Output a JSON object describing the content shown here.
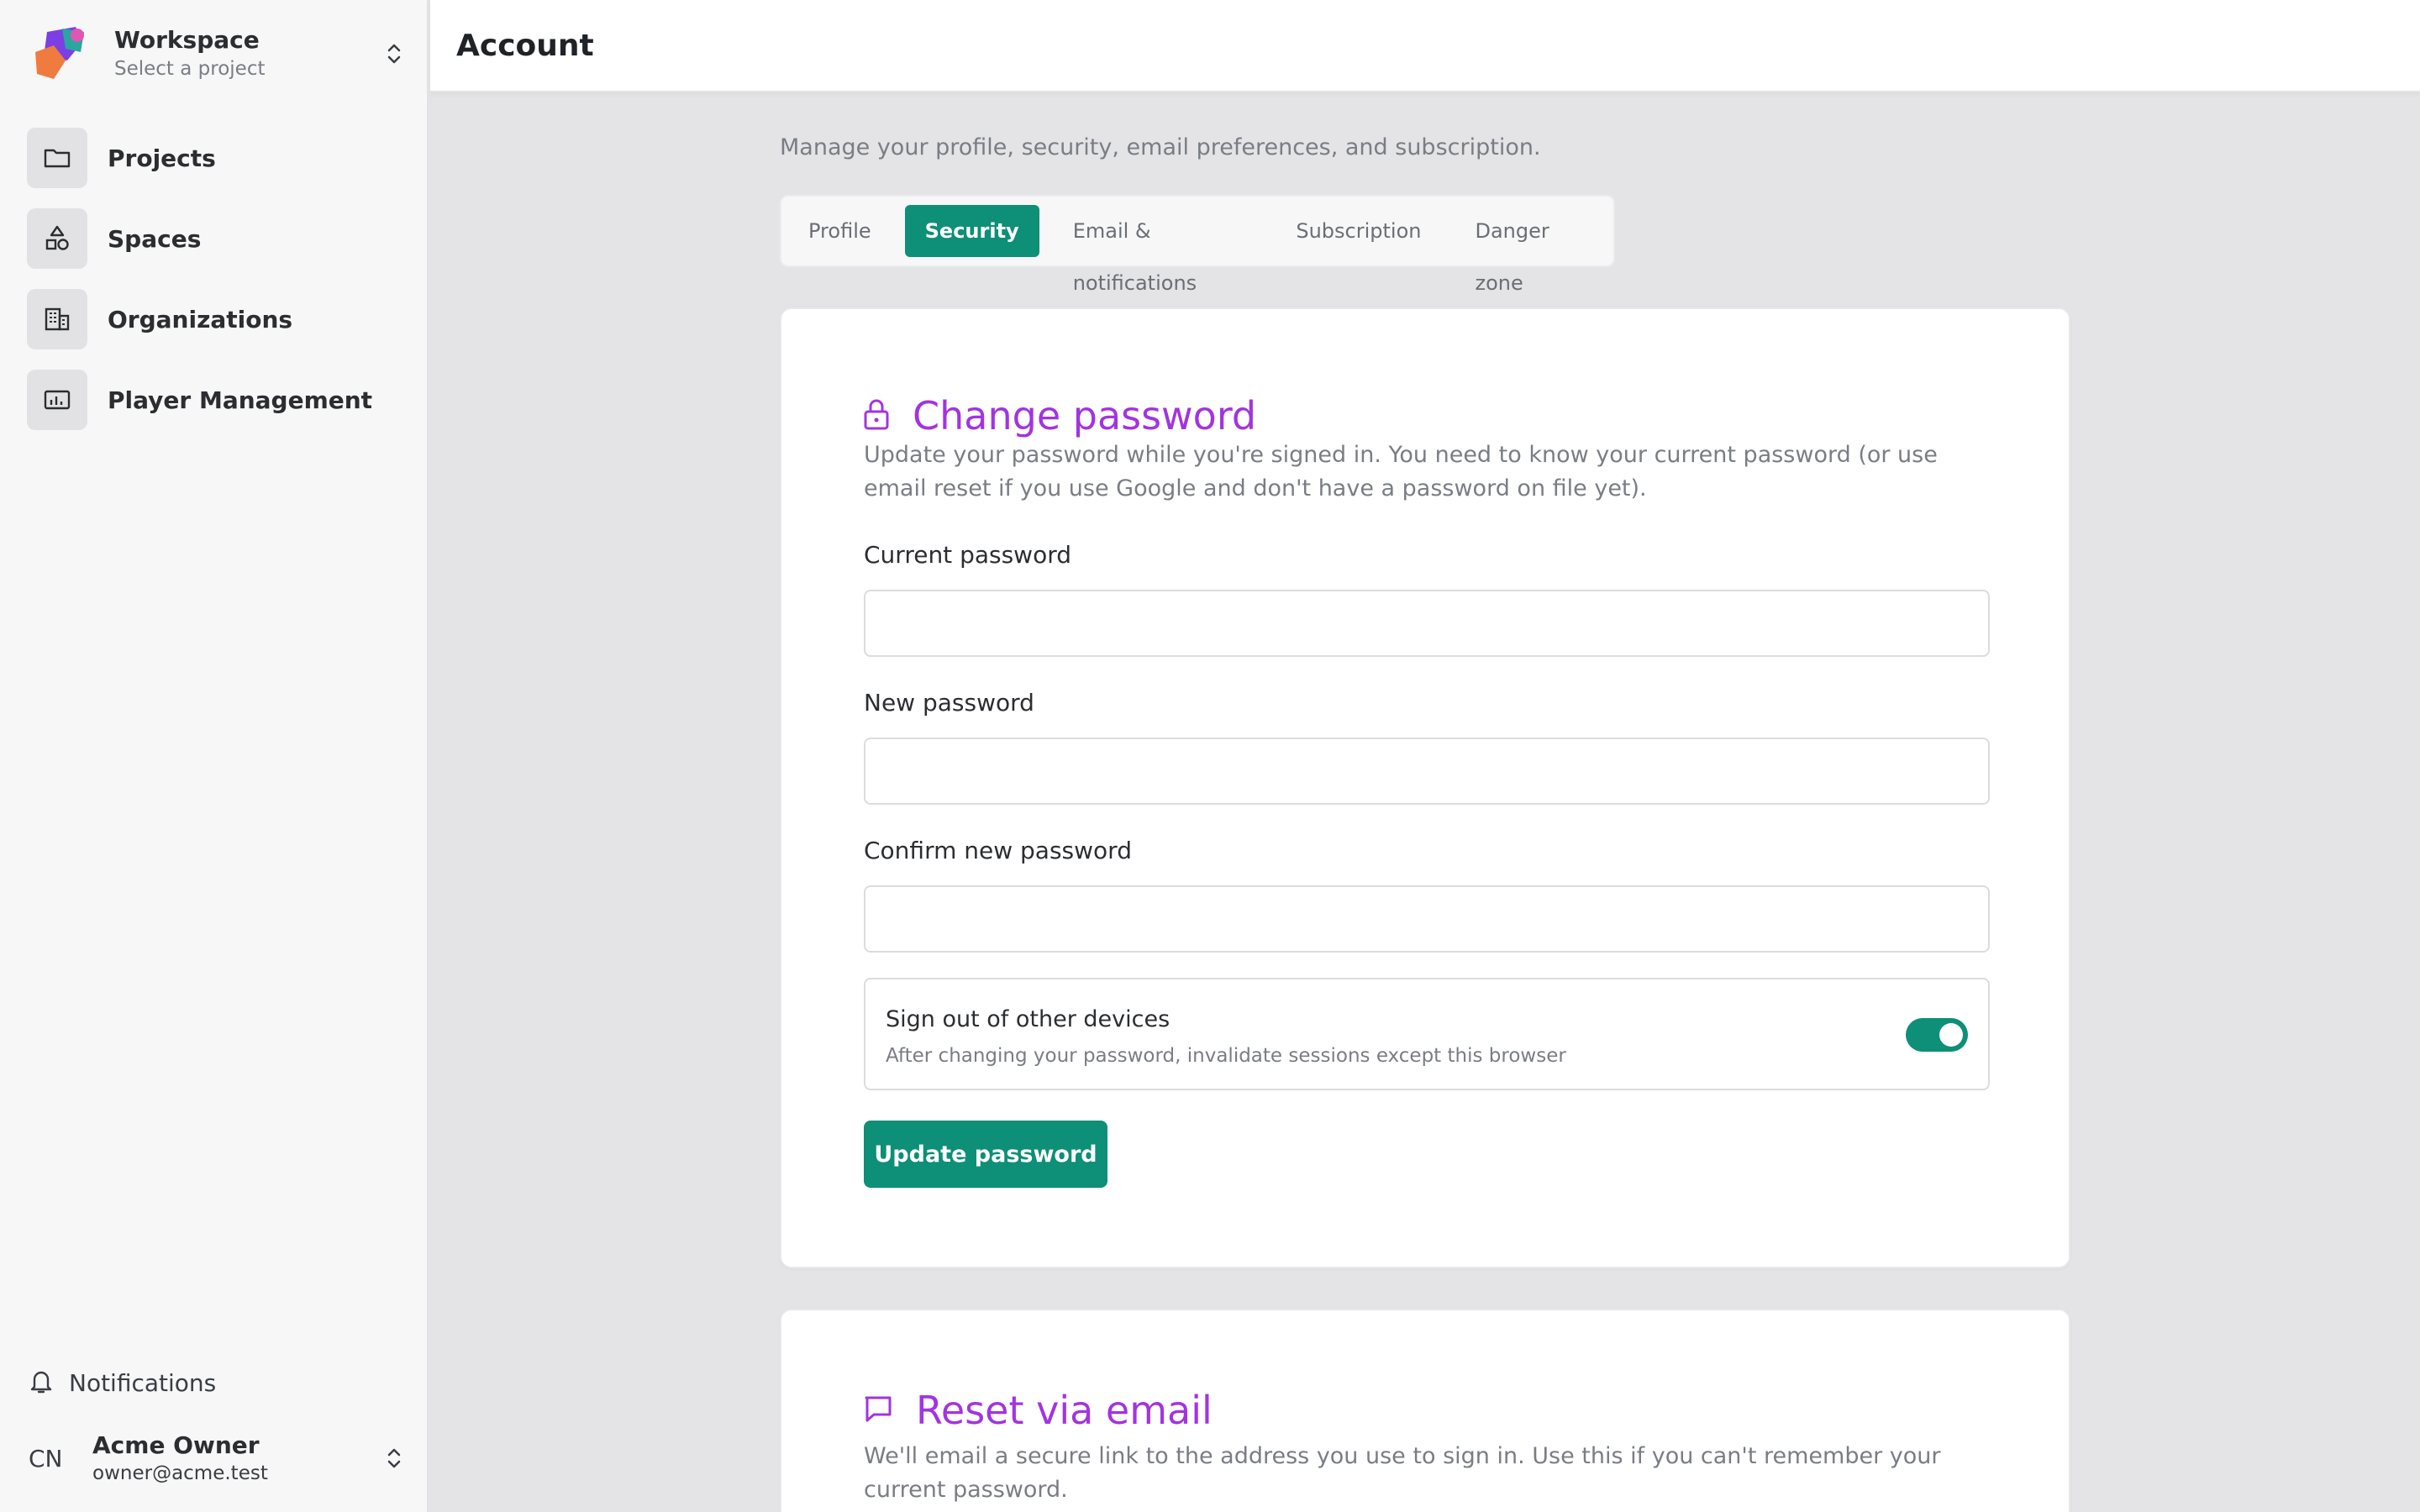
{
  "workspace": {
    "title": "Workspace",
    "subtitle": "Select a project"
  },
  "sidebar": {
    "items": [
      {
        "label": "Projects",
        "icon": "folder-icon"
      },
      {
        "label": "Spaces",
        "icon": "shapes-icon"
      },
      {
        "label": "Organizations",
        "icon": "building-icon"
      },
      {
        "label": "Player Management",
        "icon": "monitor-chart-icon"
      }
    ],
    "notifications": "Notifications",
    "user": {
      "initials": "CN",
      "name": "Acme Owner",
      "email": "owner@acme.test"
    }
  },
  "header": {
    "title": "Account"
  },
  "main": {
    "intro": "Manage your profile, security, email preferences, and subscription.",
    "tabs": [
      {
        "label": "Profile",
        "active": false
      },
      {
        "label": "Security",
        "active": true
      },
      {
        "label": "Email & notifications",
        "active": false
      },
      {
        "label": "Subscription",
        "active": false
      },
      {
        "label": "Danger zone",
        "active": false
      }
    ]
  },
  "change_password": {
    "title": "Change password",
    "description": "Update your password while you're signed in. You need to know your current password (or use email reset if you use Google and don't have a password on file yet).",
    "current_label": "Current password",
    "current_value": "",
    "new_label": "New password",
    "new_value": "",
    "confirm_label": "Confirm new password",
    "confirm_value": "",
    "signout_title": "Sign out of other devices",
    "signout_desc": "After changing your password, invalidate sessions except this browser",
    "signout_enabled": true,
    "submit_label": "Update password"
  },
  "reset_email": {
    "title": "Reset via email",
    "description": "We'll email a secure link to the address you use to sign in. Use this if you can't remember your current password."
  },
  "colors": {
    "accent": "#0e8f77",
    "heading": "#a234e0"
  }
}
